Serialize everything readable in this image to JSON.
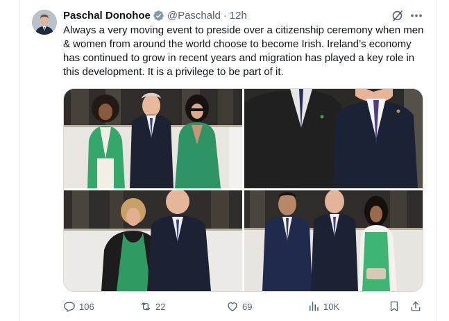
{
  "tweet": {
    "author_name": "Paschal Donohoe",
    "handle": "@Paschald",
    "separator": "·",
    "time": "12h",
    "verified": true,
    "text": "Always a very moving event to preside over a citizenship ceremony when men & women from around the world choose to become Irish. Ireland’s economy has continued to grow in recent years and migration has played a key role in this development. It is a privilege to be part of it.",
    "media_count": 4
  },
  "actions": {
    "replies": "106",
    "reposts": "22",
    "likes": "69",
    "views": "10K"
  },
  "icons": {
    "verified": "verified-badge-icon",
    "grok": "grok-icon",
    "more": "more-icon",
    "reply": "reply-icon",
    "repost": "repost-icon",
    "like": "heart-icon",
    "views": "views-icon",
    "bookmark": "bookmark-icon",
    "share": "share-icon"
  },
  "colors": {
    "text_primary": "#0f1419",
    "text_secondary": "#536471",
    "verified_blue": "#829aab",
    "border": "#cfd9de"
  }
}
